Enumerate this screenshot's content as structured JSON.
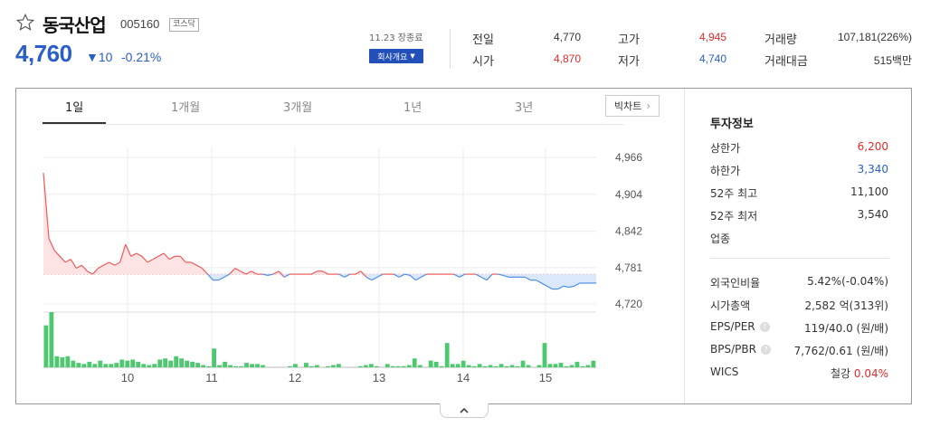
{
  "stock": {
    "name": "동국산업",
    "code": "005160",
    "market": "코스닥",
    "price": "4,760",
    "change": "10",
    "change_pct": "-0.21%",
    "date_status": "11.23 장종료",
    "company_button": "회사개요"
  },
  "quote": {
    "prev_label": "전일",
    "prev": "4,770",
    "open_label": "시가",
    "open": "4,870",
    "high_label": "고가",
    "high": "4,945",
    "low_label": "저가",
    "low": "4,740",
    "volume_label": "거래량",
    "volume": "107,181(226%)",
    "amount_label": "거래대금",
    "amount": "515백만"
  },
  "tabs": [
    "1일",
    "1개월",
    "3개월",
    "1년",
    "3년"
  ],
  "active_tab": "1일",
  "big_chart_label": "빅차트",
  "chart_data": {
    "type": "line",
    "title": "",
    "y_ticks": [
      "4,966",
      "4,904",
      "4,842",
      "4,781",
      "4,720"
    ],
    "ylim": [
      4720,
      4966
    ],
    "baseline": 4770,
    "x_ticks": [
      "10",
      "11",
      "12",
      "13",
      "14",
      "15"
    ],
    "prices": [
      4940,
      4830,
      4810,
      4800,
      4790,
      4795,
      4780,
      4785,
      4775,
      4770,
      4780,
      4785,
      4790,
      4785,
      4790,
      4820,
      4800,
      4805,
      4800,
      4790,
      4795,
      4800,
      4805,
      4795,
      4800,
      4800,
      4790,
      4790,
      4785,
      4780,
      4770,
      4760,
      4760,
      4765,
      4770,
      4780,
      4775,
      4770,
      4775,
      4770,
      4770,
      4768,
      4770,
      4775,
      4765,
      4770,
      4770,
      4770,
      4770,
      4770,
      4775,
      4775,
      4770,
      4770,
      4770,
      4765,
      4770,
      4770,
      4775,
      4765,
      4760,
      4765,
      4770,
      4770,
      4770,
      4765,
      4770,
      4768,
      4760,
      4765,
      4770,
      4770,
      4770,
      4770,
      4770,
      4770,
      4765,
      4770,
      4770,
      4770,
      4765,
      4760,
      4770,
      4770,
      4768,
      4765,
      4765,
      4765,
      4765,
      4760,
      4760,
      4755,
      4750,
      4745,
      4745,
      4750,
      4748,
      4750,
      4755,
      4755,
      4755,
      4755
    ],
    "volumes": [
      38,
      50,
      10,
      9,
      10,
      6,
      4,
      3,
      5,
      3,
      6,
      3,
      3,
      4,
      7,
      6,
      7,
      5,
      3,
      2,
      3,
      7,
      8,
      6,
      10,
      8,
      6,
      5,
      4,
      2,
      1,
      17,
      2,
      5,
      2,
      1,
      1,
      4,
      3,
      3,
      2,
      0,
      0,
      0,
      0,
      1,
      3,
      0,
      4,
      1,
      2,
      0,
      1,
      2,
      3,
      0,
      0,
      0,
      1,
      2,
      3,
      1,
      0,
      3,
      1,
      1,
      1,
      2,
      8,
      2,
      0,
      6,
      5,
      1,
      22,
      3,
      3,
      6,
      2,
      1,
      3,
      1,
      2,
      1,
      3,
      1,
      2,
      1,
      6,
      2,
      0,
      2,
      22,
      3,
      3,
      4,
      1,
      2,
      5,
      1,
      2,
      6
    ]
  },
  "invest": {
    "title": "투자정보",
    "upper_label": "상한가",
    "upper": "6,200",
    "lower_label": "하한가",
    "lower": "3,340",
    "w52_high_label": "52주 최고",
    "w52_high": "11,100",
    "w52_low_label": "52주 최저",
    "w52_low": "3,540",
    "sector_label": "업종",
    "foreign_label": "외국인비율",
    "foreign": "5.42%(-0.04%)",
    "mcap_label": "시가총액",
    "mcap": "2,582 억(313위)",
    "eps_label": "EPS/PER",
    "eps": "119/40.0 (원/배)",
    "bps_label": "BPS/PBR",
    "bps": "7,762/0.61 (원/배)",
    "wics_label": "WICS",
    "wics_name": "철강",
    "wics_pct": "0.04%"
  },
  "colors": {
    "up": "#e02a2a",
    "down": "#2a5ec8",
    "volume": "#4cc86e"
  }
}
